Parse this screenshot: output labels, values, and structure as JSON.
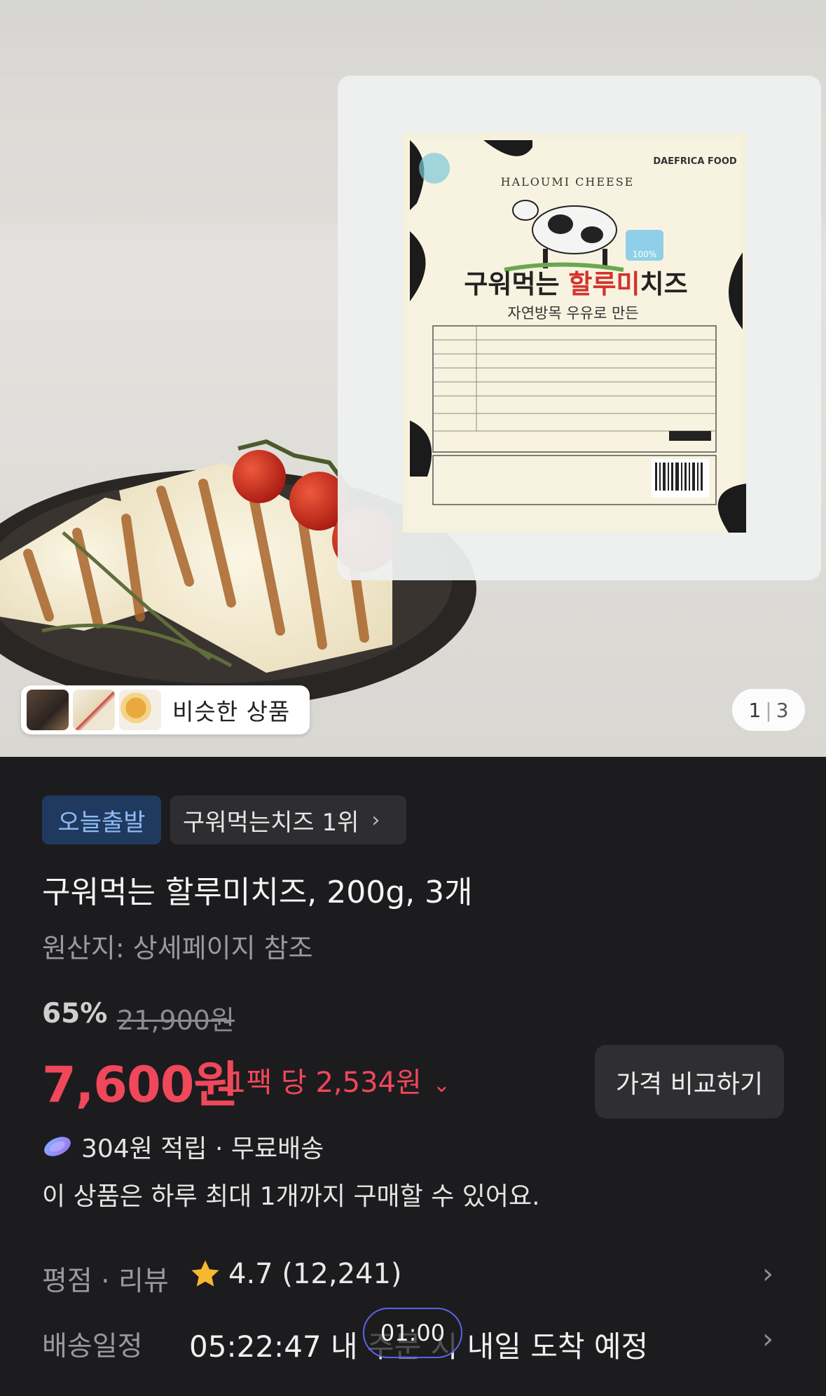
{
  "product_image": {
    "similar_button_label": "비슷한 상품",
    "page_current": "1",
    "page_total": "3",
    "package": {
      "label_en": "HALOUMI CHEESE",
      "brand": "DAEFRICA FOOD",
      "name_part1": "구워먹는 ",
      "name_part2": "할루미",
      "name_part3": "치즈",
      "subtitle": "자연방목 우유로 만든",
      "badge": "100%"
    }
  },
  "tags": {
    "today_ship": "오늘출발",
    "rank": "구워먹는치즈 1위",
    "rank_chevron": "›"
  },
  "product": {
    "title": "구워먹는 할루미치즈, 200g, 3개",
    "origin": "원산지: 상세페이지 참조"
  },
  "pricing": {
    "discount": "65%",
    "original_price": "21,900원",
    "price": "7,600원",
    "unit_price": "1팩 당 2,534원",
    "unit_dropdown": "⌄",
    "compare_button": "가격 비교하기"
  },
  "benefits": {
    "points": "304원 적립 · 무료배송",
    "limit_notice": "이 상품은 하루 최대 1개까지 구매할 수 있어요."
  },
  "rating_row": {
    "label": "평점 · 리뷰",
    "score": "4.7",
    "count": "(12,241)",
    "chevron": "›"
  },
  "delivery_row": {
    "label": "배송일정",
    "text": "05:22:47 내 주문 시 내일 도착 예정",
    "chevron": "›"
  },
  "timer_overlay": "01:00",
  "colors": {
    "background": "#1c1c1e",
    "price_red": "#f0475a",
    "tag_blue_bg": "#203a5f",
    "tag_blue_text": "#8fbbf4",
    "star": "#f5b82e",
    "timer_border": "#5d63e8"
  }
}
